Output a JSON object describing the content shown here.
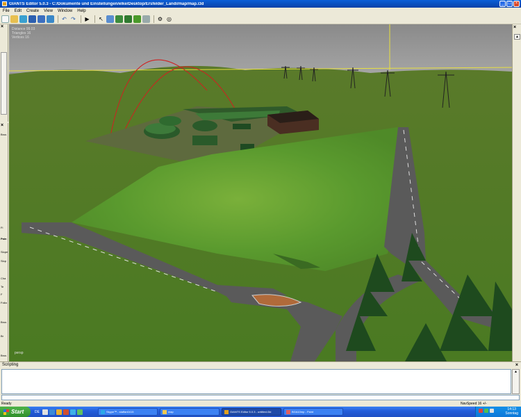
{
  "window": {
    "title": "GIANTS Editor 5.0.3 - C:/Dokumente und Einstellungen/elke/Desktop/Ersfelder_Landi/map/map.i3d"
  },
  "menu": [
    "File",
    "Edit",
    "Create",
    "View",
    "Window",
    "Help"
  ],
  "toolbar": {
    "icons": [
      "new-icon",
      "open-icon",
      "reload-icon",
      "save-icon",
      "save-as-icon",
      "import-icon",
      "undo-icon",
      "redo-icon",
      "play-icon",
      "select-icon",
      "terrain-icon",
      "paint-icon",
      "foliage-icon",
      "grass-icon",
      "settings-icon",
      "camera-icon"
    ]
  },
  "viewport": {
    "stats": {
      "distance": "Distance 99.03",
      "triangles": "Triangles 16",
      "vertices": "Vertices 16"
    },
    "camera": "persp"
  },
  "side_labels": [
    "Brus",
    "Fi",
    "Pain",
    "Slope",
    "Slop",
    "Cha",
    "Te",
    "F",
    "Folia",
    "Brus",
    "Br",
    "Brus"
  ],
  "scripting": {
    "title": "Scripting"
  },
  "status": {
    "left": "Ready",
    "nav_speed": "NavSpeed 16 +/-"
  },
  "taskbar": {
    "start": "Start",
    "lang": "DE",
    "tasks": [
      "Skype™ - staffan0415",
      "map",
      "GIANTS Editor 5.0.3 - untitled.i3d",
      "BGA10mp - Paint"
    ],
    "time": "14:13",
    "day": "Sonntag"
  },
  "colors": {
    "titlebar": "#0a5fd8",
    "sky": "#8f8f8f",
    "grass": "#4f7a23",
    "road": "#5a5a5a",
    "taskbar": "#245edb",
    "start": "#3c9c35"
  }
}
